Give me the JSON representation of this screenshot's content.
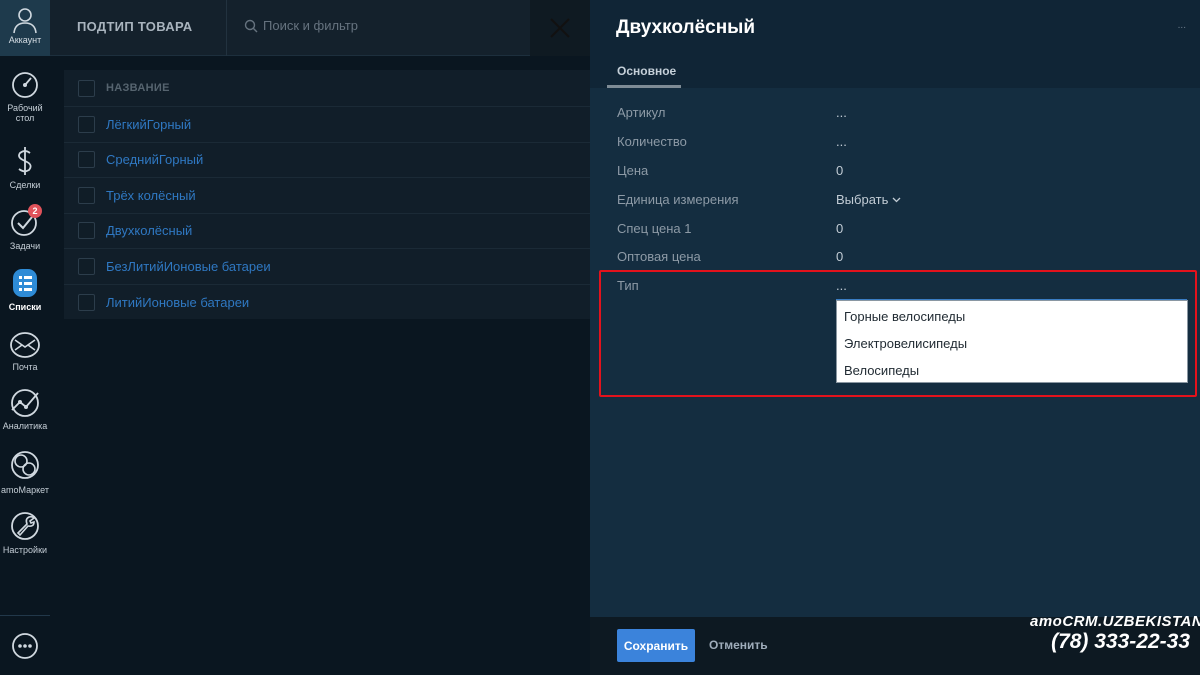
{
  "nav": {
    "account": "Аккаунт",
    "items": [
      {
        "label": "Рабочий стол",
        "icon": "dashboard-icon"
      },
      {
        "label": "Сделки",
        "icon": "dollar-icon"
      },
      {
        "label": "Задачи",
        "icon": "check-icon",
        "badge": "2"
      },
      {
        "label": "Списки",
        "icon": "lists-icon",
        "active": true
      },
      {
        "label": "Почта",
        "icon": "mail-icon"
      },
      {
        "label": "Аналитика",
        "icon": "analytics-icon"
      },
      {
        "label": "amoМаркет",
        "icon": "market-icon"
      },
      {
        "label": "Настройки",
        "icon": "wrench-icon"
      }
    ],
    "chat_icon": "chat-icon"
  },
  "topbar": {
    "title": "ПОДТИП ТОВАРА",
    "search_placeholder": "Поиск и фильтр"
  },
  "list": {
    "header": "НАЗВАНИЕ",
    "rows": [
      "ЛёгкийГорный",
      "СреднийГорный",
      "Трёх колёсный",
      "Двухколёсный",
      "БезЛитийИоновые батареи",
      "ЛитийИоновые батареи"
    ]
  },
  "panel": {
    "title": "Двухколёсный",
    "more": "...",
    "tab": "Основное",
    "fields": [
      {
        "label": "Артикул",
        "value": "..."
      },
      {
        "label": "Количество",
        "value": "..."
      },
      {
        "label": "Цена",
        "value": "0"
      },
      {
        "label": "Единица измерения",
        "value": "Выбрать"
      },
      {
        "label": "Спец цена 1",
        "value": "0"
      },
      {
        "label": "Оптовая цена",
        "value": "0"
      }
    ],
    "type_label": "Тип",
    "type_value": "...",
    "type_options": [
      "Горные велосипеды",
      "Электровелисипеды",
      "Велосипеды"
    ]
  },
  "footer": {
    "save": "Сохранить",
    "cancel": "Отменить"
  },
  "brand": {
    "line1": "amoCRM.UZBEKISTAN",
    "phone": "(78) 333-22-33"
  },
  "colors": {
    "accent": "#3b83db",
    "highlight": "#e3121c",
    "badge": "#e0525a",
    "link": "#2f78c2"
  }
}
